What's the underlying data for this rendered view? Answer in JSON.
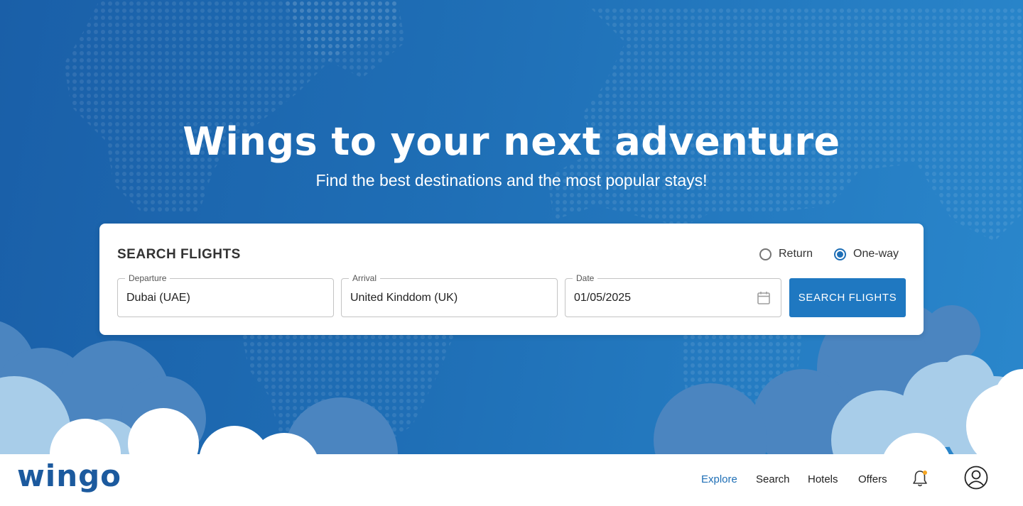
{
  "hero": {
    "title": "Wings to your next adventure",
    "subtitle": "Find the best destinations and the most popular stays!",
    "bg_color_start": "#1a5fa8",
    "bg_color_end": "#2a87cc"
  },
  "search_card": {
    "title": "SEARCH FLIGHTS",
    "trip_types": [
      {
        "label": "Return",
        "selected": false
      },
      {
        "label": "One-way",
        "selected": true
      }
    ],
    "fields": {
      "departure": {
        "label": "Departure",
        "value": "Dubai (UAE)"
      },
      "arrival": {
        "label": "Arrival",
        "value": "United Kinddom (UK)"
      },
      "date": {
        "label": "Date",
        "value": "01/05/2025",
        "icon": "calendar-icon"
      }
    },
    "search_button": "SEARCH FLIGHTS"
  },
  "navbar": {
    "logo": "wingo",
    "links": [
      {
        "label": "Explore",
        "active": true
      },
      {
        "label": "Search",
        "active": false
      },
      {
        "label": "Hotels",
        "active": false
      },
      {
        "label": "Offers",
        "active": false
      }
    ],
    "notification_icon": "bell-icon",
    "notification_dot_color": "#f5a623",
    "profile_icon": "user-circle-icon"
  },
  "colors": {
    "accent": "#1f6fb6",
    "logo": "#1c5a9e",
    "button": "#1f78c1"
  }
}
